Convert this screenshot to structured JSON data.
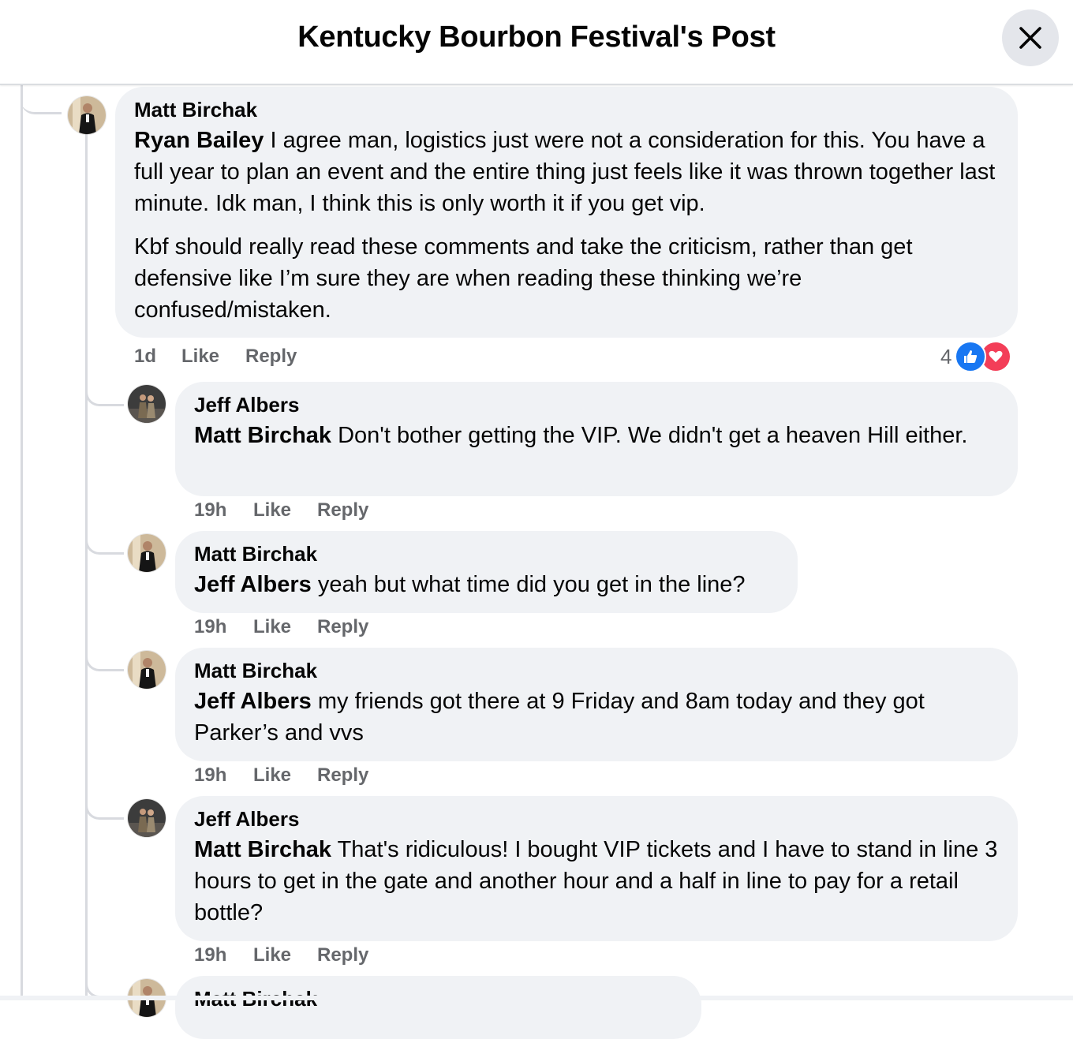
{
  "header": {
    "title": "Kentucky Bourbon Festival's Post",
    "close_icon": "close-icon"
  },
  "comments": [
    {
      "author": "Matt Birchak",
      "mention": "Ryan Bailey",
      "text": " I agree man, logistics just were not a consideration for this. You have a full year to plan an event and the entire thing just feels like it was thrown together last minute. Idk man, I think this is only worth it if you get vip.",
      "text2": "Kbf should really read these comments and take the criticism, rather than get defensive like I’m sure they are when reading these thinking we’re confused/mistaken.",
      "time": "1d",
      "like": "Like",
      "reply": "Reply",
      "reaction_count": "4",
      "reaction_icons": [
        "like-reaction-icon",
        "love-reaction-icon"
      ]
    },
    {
      "author": "Jeff Albers",
      "mention": "Matt Birchak",
      "text": " Don't bother getting the VIP. We didn't get a heaven Hill either.",
      "time": "19h",
      "like": "Like",
      "reply": "Reply"
    },
    {
      "author": "Matt Birchak",
      "mention": "Jeff Albers",
      "text": " yeah but what time did you get in the line?",
      "time": "19h",
      "like": "Like",
      "reply": "Reply"
    },
    {
      "author": "Matt Birchak",
      "mention": "Jeff Albers",
      "text": " my friends got there at 9 Friday and 8am today and they got Parker’s and vvs",
      "time": "19h",
      "like": "Like",
      "reply": "Reply"
    },
    {
      "author": "Jeff Albers",
      "mention": "Matt Birchak",
      "text": " That's ridiculous! I bought VIP tickets and I have to stand in line 3 hours to get in the gate and another hour and a half in line to pay for a retail bottle?",
      "time": "19h",
      "like": "Like",
      "reply": "Reply"
    },
    {
      "author": "Matt Birchak"
    }
  ],
  "colors": {
    "bubble": "#f0f2f5",
    "meta_text": "#65676b",
    "like_blue": "#1877f2",
    "love_red": "#f33e58"
  }
}
